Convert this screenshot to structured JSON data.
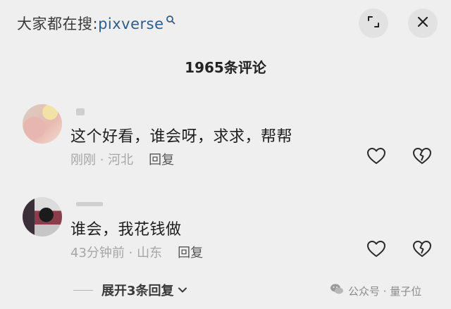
{
  "header": {
    "search_prefix": "大家都在搜:",
    "search_query": "pixverse"
  },
  "comments_title": "1965条评论",
  "comments": [
    {
      "text": "这个好看，谁会呀，求求，帮帮",
      "time": "刚刚",
      "location": "河北",
      "reply_label": "回复"
    },
    {
      "text": "谁会，我花钱做",
      "time": "43分钟前",
      "location": "山东",
      "reply_label": "回复"
    }
  ],
  "expand_replies_label": "展开3条回复",
  "watermark": "公众号 · 量子位",
  "icons": [
    "search-icon",
    "expand-icon",
    "close-icon",
    "heart-icon",
    "broken-heart-icon",
    "chevron-down-icon",
    "wechat-icon"
  ]
}
